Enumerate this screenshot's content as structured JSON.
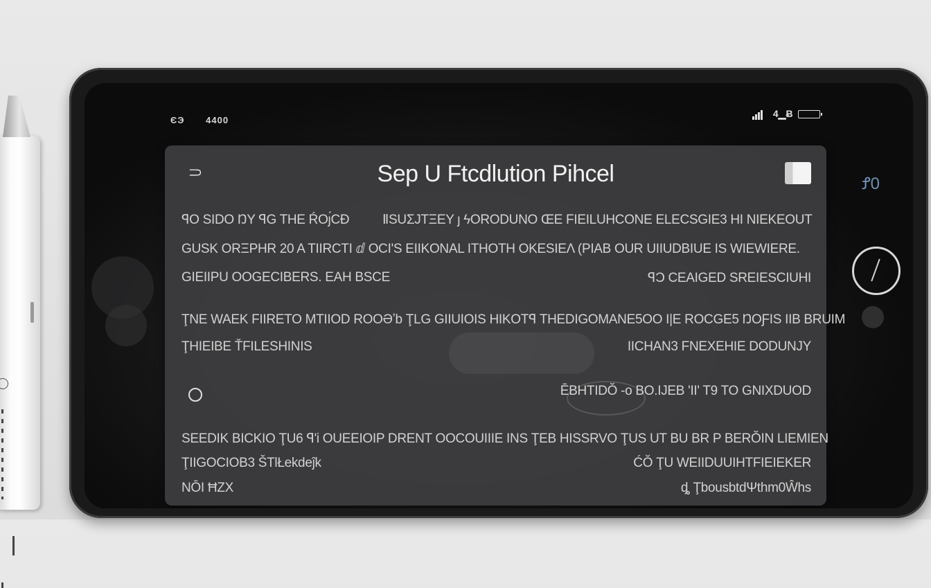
{
  "status_bar": {
    "left_a": "ЄЭ",
    "left_b": "4400",
    "right_text": "4▁Ƀ"
  },
  "side": {
    "label": "Ꝭ0"
  },
  "dialog": {
    "back_glyph": "⸧",
    "title": "Sep U Ftcdlution Pihcel",
    "rows": [
      {
        "left": "ꟼO SIDO ŊY ꟼG THE ŔOȷ́CÐ",
        "center": "ⅡSUΣJTΞEY ȷ ϟORODUNO ŒE FIEILUHCONE ELECSGIE3 HI NIEKEOUT"
      },
      {
        "left": "GUSK ORΞPHR 20 A TIIRCTI ⅆ OCI'S EIIKONAL ITHOTH OKESIEΛ (PIAB OUR UIIUDBIUE IS WIEWIERE."
      },
      {
        "left": "GIEIIPU OOGECIBERS. EAH BSCE",
        "right": "ꟼƆ CEAIGED SREIESCIUHI"
      },
      {
        "left": "ŢNE WAEK FIIRETO MTIIOD ROOƏʼb ŢLG GIIUIOIS HIKOTꟼ THEDIGOMANE5OO I|E ROCGE5 ŊOƑIS IIB BRUIM"
      },
      {
        "left": "ŢHIEIBE ŤFILESHINIS",
        "right": "IICHAN3 FNEXEHIE DODUNJY"
      },
      {
        "right": "ĒBHTIDŎ -o BO.IJEB 'II' T9 TO GNIXDUOD"
      },
      {
        "left": "SEEDIK BICKIO ŢU6 ꟼ'i OUEEIOIP DRENT OOCOUIIIE INS ŢEB HISSRVO ŢUS UT BU BR P BERŎIN LIEMIEN"
      },
      {
        "left": "ŢIIGOCIOB3 ŠTlŁekdeĵk",
        "right": "ĆŎ ŢU WEIIDUUIHTFIEIEKER"
      },
      {
        "left": "NŌI ĦZX",
        "right": "ȡ ŢbousbtdΨthm0Ŵhs"
      }
    ]
  }
}
